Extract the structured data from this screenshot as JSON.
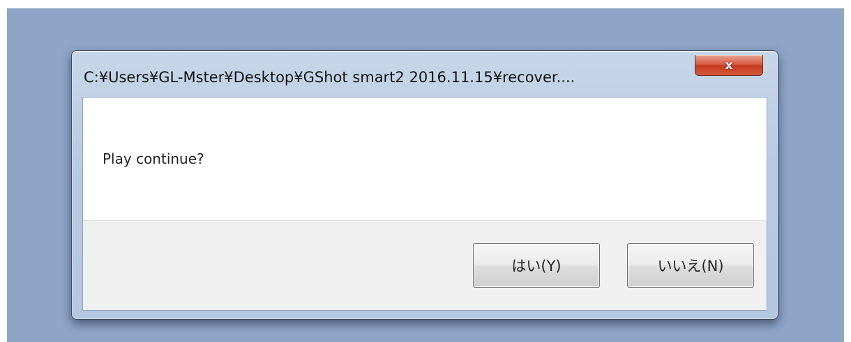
{
  "dialog": {
    "title": "C:¥Users¥GL-Mster¥Desktop¥GShot smart2 2016.11.15¥recover....",
    "close_label": "x",
    "message": "Play continue?",
    "buttons": {
      "yes_label": "はい(Y)",
      "no_label": "いいえ(N)"
    }
  },
  "icons": {
    "close": "close-icon"
  },
  "colors": {
    "desktop_background": "#8ea5c8",
    "window_frame": "#b9cbe2",
    "close_button": "#d7553e",
    "button_area": "#f0f0f0"
  }
}
